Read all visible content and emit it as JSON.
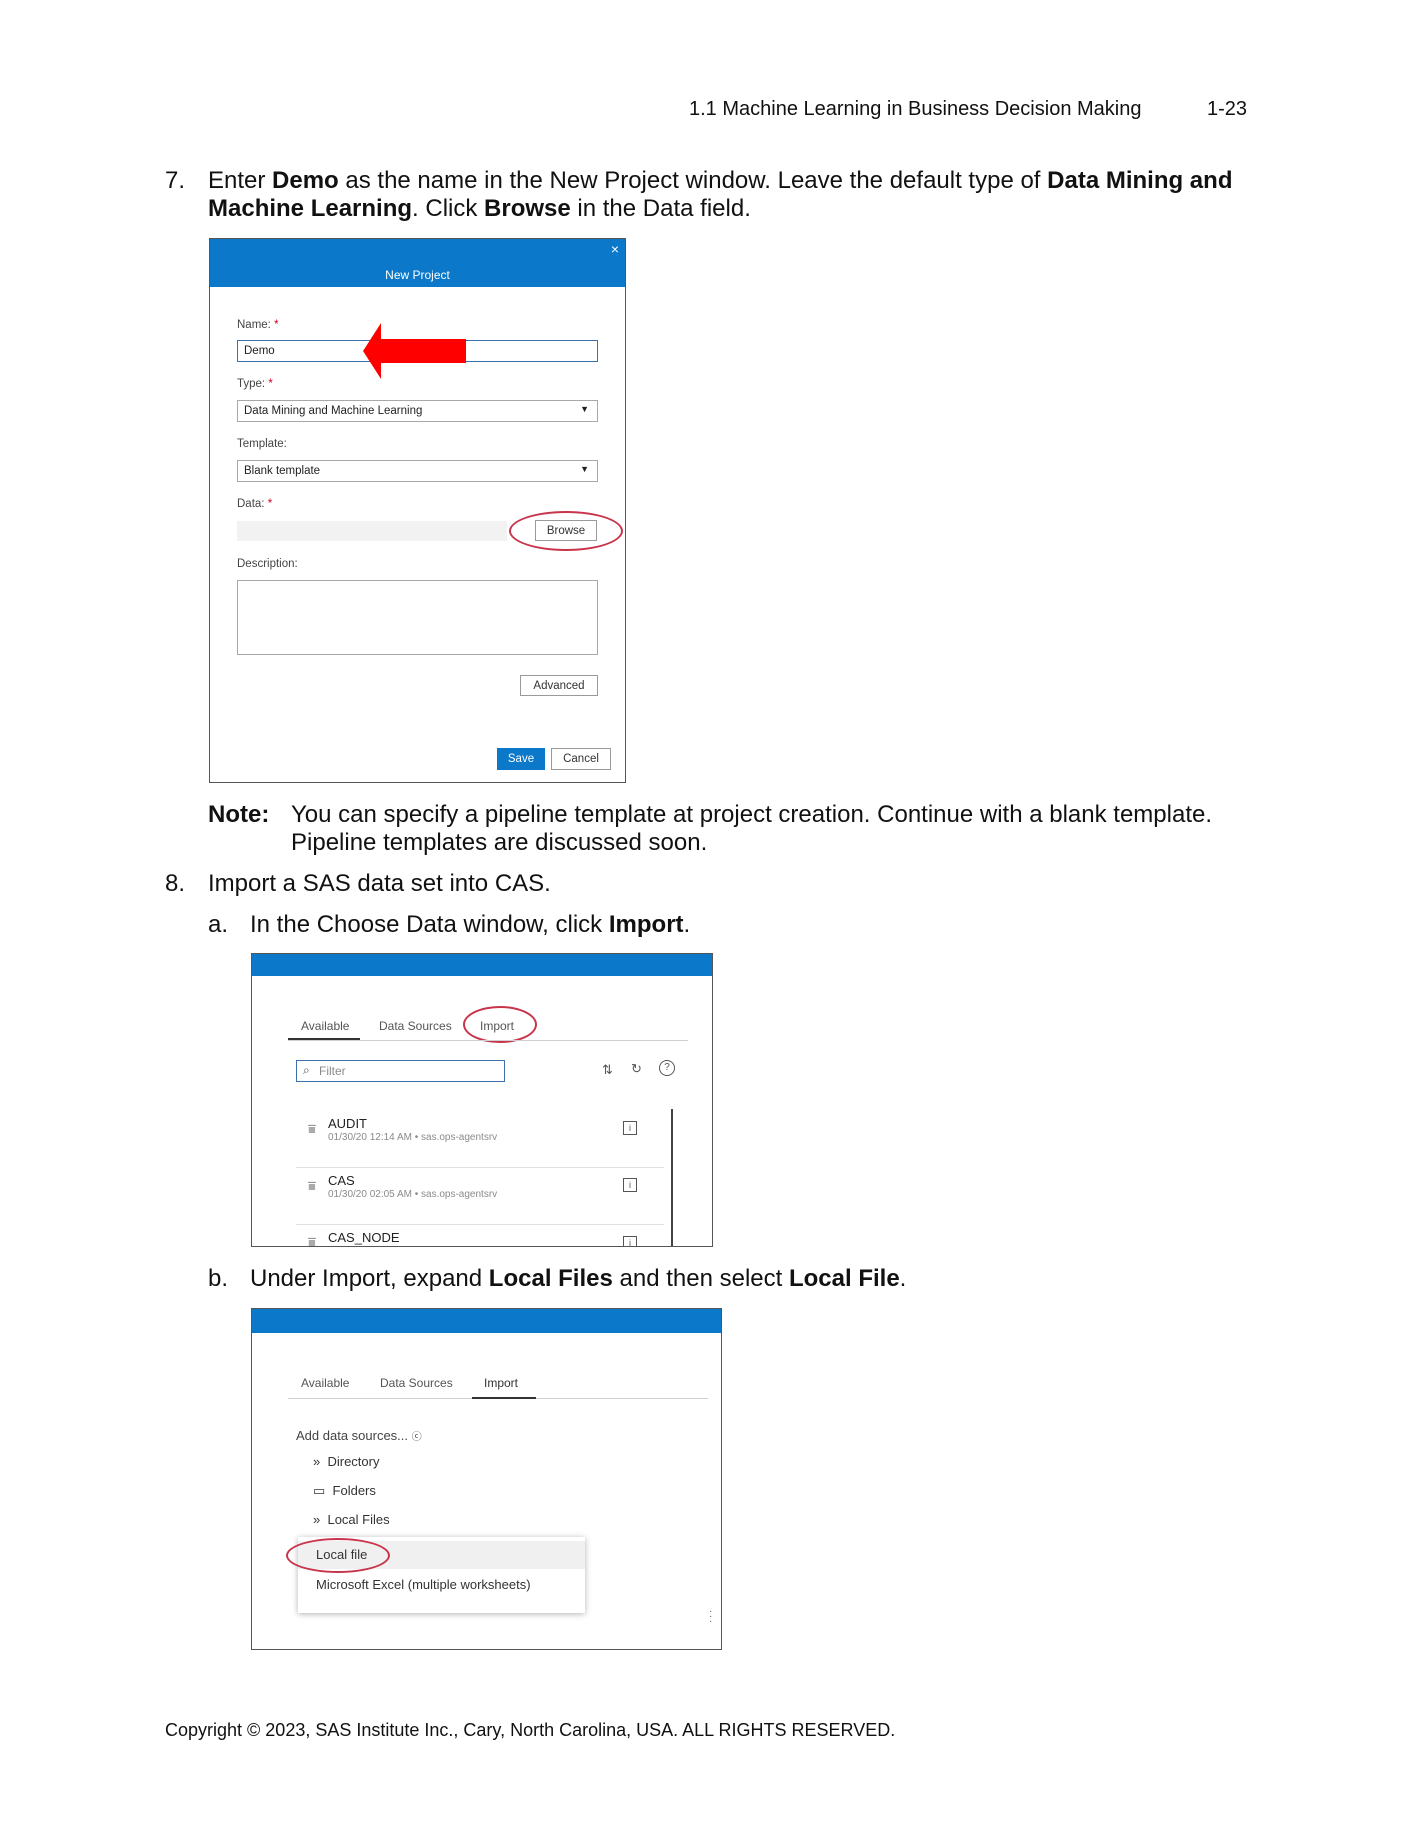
{
  "header": {
    "section": "1.1  Machine Learning in Business Decision Making",
    "page": "1-23"
  },
  "step7": {
    "num": "7.",
    "line1_pre": "Enter ",
    "line1_b1": "Demo",
    "line1_mid": " as the name in the New Project window. Leave the default type of ",
    "line1_b2": "Data Mining and",
    "line2_b": "Machine Learning",
    "line2_mid": ". Click ",
    "line2_b2": "Browse",
    "line2_post": " in the Data field."
  },
  "new_project": {
    "title": "New Project",
    "close": "×",
    "name_label": "Name:",
    "name_value": "Demo",
    "type_label": "Type:",
    "type_value": "Data Mining and Machine Learning",
    "template_label": "Template:",
    "template_value": "Blank template",
    "data_label": "Data:",
    "browse": "Browse",
    "description_label": "Description:",
    "advanced": "Advanced",
    "save": "Save",
    "cancel": "Cancel",
    "required_mark": "*",
    "arrow_color": "#ff0000"
  },
  "note": {
    "label": "Note:",
    "line1": "You can specify a pipeline template at project creation. Continue with a blank template.",
    "line2": "Pipeline templates are discussed soon."
  },
  "step8": {
    "num": "8.",
    "text": "Import a SAS data set into CAS.",
    "a_num": "a.",
    "a_pre": "In the Choose Data window, click ",
    "a_b": "Import",
    "a_post": ".",
    "b_num": "b.",
    "b_pre": "Under Import, expand ",
    "b_b1": "Local Files",
    "b_mid": " and then select ",
    "b_b2": "Local File",
    "b_post": "."
  },
  "choose_data_a": {
    "tabs": [
      "Available",
      "Data Sources",
      "Import"
    ],
    "filter_placeholder": "Filter",
    "tables": [
      {
        "name": "AUDIT",
        "meta": "01/30/20 12:14 AM • sas.ops-agentsrv"
      },
      {
        "name": "CAS",
        "meta": "01/30/20 02:05 AM • sas.ops-agentsrv"
      },
      {
        "name": "CAS_NODE",
        "meta": ""
      }
    ]
  },
  "choose_data_b": {
    "tabs": [
      "Available",
      "Data Sources",
      "Import"
    ],
    "add_sources": "Add data sources...",
    "items": [
      "Directory",
      "Folders",
      "Local Files"
    ],
    "menu": [
      "Local file",
      "Microsoft Excel (multiple worksheets)"
    ]
  },
  "footer": {
    "copyright": "Copyright © 2023, SAS Institute Inc., Cary, North Carolina, USA. ALL RIGHTS RESERVED."
  },
  "colors": {
    "sas_blue": "#0b78c9",
    "highlight_oval": "#c8344a"
  }
}
